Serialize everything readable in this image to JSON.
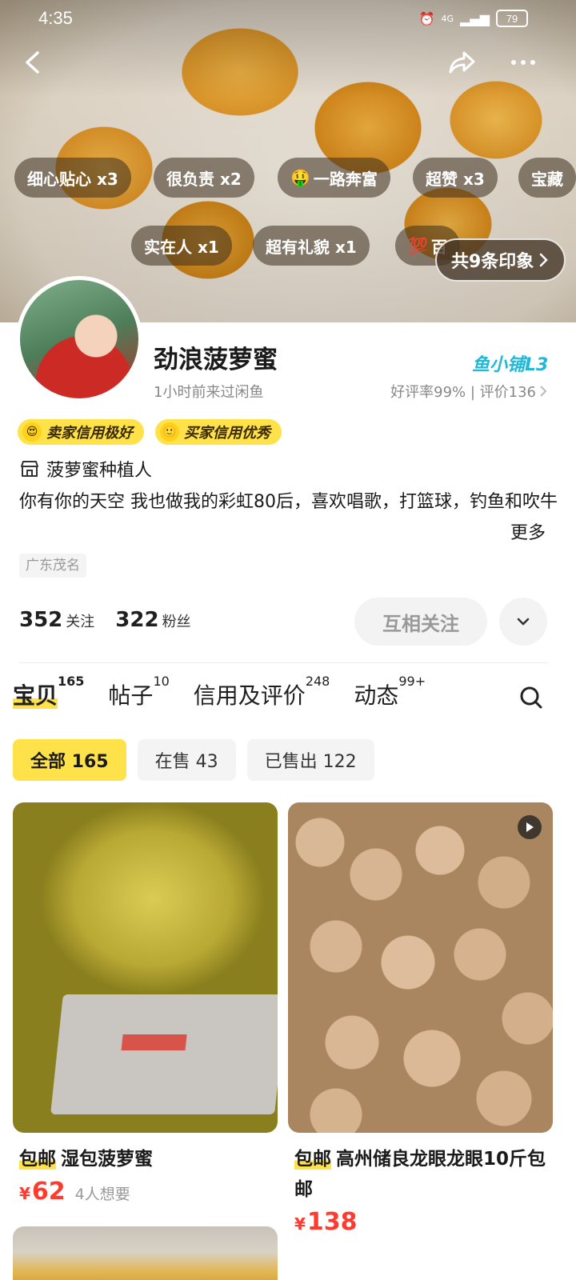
{
  "status_bar": {
    "time": "4:35",
    "alarm": "⏰",
    "network": "4G",
    "battery": "79"
  },
  "header": {
    "back_icon": "back-arrow-icon",
    "share_icon": "share-icon",
    "more_icon": "more-dots-icon"
  },
  "impression_chips": [
    {
      "label": "细心贴心 x3"
    },
    {
      "label": "很负责 x2"
    },
    {
      "label": "一路奔富",
      "emoji": "🤑"
    },
    {
      "label": "超赞 x3"
    },
    {
      "label": "宝藏"
    },
    {
      "label": "实在人 x1"
    },
    {
      "label": "超有礼貌 x1"
    },
    {
      "label": "百",
      "emoji": "💯"
    }
  ],
  "impression_total": "共9条印象",
  "profile": {
    "username": "劲浪菠萝蜜",
    "last_seen": "1小时前来过闲鱼",
    "shop_badge": "鱼小铺L3",
    "rating": "好评率99% | 评价136",
    "seller_credit": "卖家信用极好",
    "buyer_credit": "买家信用优秀",
    "role": "菠萝蜜种植人",
    "bio": "你有你的天空 我也做我的彩虹80后，喜欢唱歌，打篮球，钓鱼和吹牛",
    "more_label": "更多",
    "location": "广东茂名"
  },
  "stats": {
    "following_count": "352",
    "following_label": "关注",
    "followers_count": "322",
    "followers_label": "粉丝"
  },
  "actions": {
    "follow_label": "互相关注"
  },
  "tabs": [
    {
      "label": "宝贝",
      "count": "165"
    },
    {
      "label": "帖子",
      "count": "10"
    },
    {
      "label": "信用及评价",
      "count": "248"
    },
    {
      "label": "动态",
      "count": "99+"
    }
  ],
  "filters": [
    {
      "label": "全部 165"
    },
    {
      "label": "在售 43"
    },
    {
      "label": "已售出 122"
    }
  ],
  "products": [
    {
      "tag": "包邮",
      "title": "湿包菠萝蜜",
      "currency": "¥",
      "price": "62",
      "want": "4人想要"
    },
    {
      "tag": "包邮",
      "title": "高州储良龙眼龙眼10斤包邮",
      "currency": "¥",
      "price": "138",
      "want": ""
    }
  ],
  "colors": {
    "accent_yellow": "#ffe24a",
    "price_red": "#ff3b30",
    "shop_badge": "#22b8d8"
  }
}
